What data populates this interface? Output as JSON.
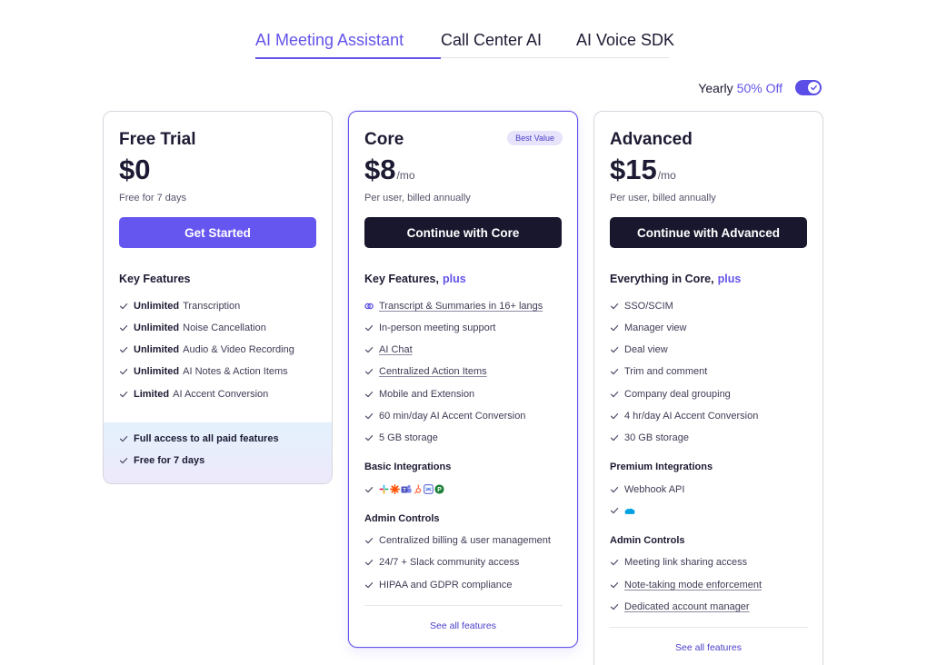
{
  "tabs": [
    {
      "label": "AI Meeting Assistant",
      "active": true
    },
    {
      "label": "Call Center AI",
      "active": false
    },
    {
      "label": "AI Voice SDK",
      "active": false
    }
  ],
  "billing": {
    "label": "Yearly",
    "discount": "50% Off",
    "yearly_enabled": true
  },
  "colors": {
    "accent": "#6353e8",
    "dark_button": "#19172e",
    "purple_button": "#6656f0"
  },
  "plans": {
    "free": {
      "name": "Free Trial",
      "price": "$0",
      "note": "Free for 7 days",
      "cta": "Get Started",
      "section_title": "Key Features",
      "features": [
        {
          "strong": "Unlimited",
          "text": "Transcription"
        },
        {
          "strong": "Unlimited",
          "text": "Noise Cancellation"
        },
        {
          "strong": "Unlimited",
          "text": "Audio & Video Recording"
        },
        {
          "strong": "Unlimited",
          "text": "AI Notes & Action Items"
        },
        {
          "strong": "Limited",
          "text": "AI Accent Conversion"
        }
      ],
      "extras": [
        "Full access to all paid features",
        "Free for 7 days"
      ]
    },
    "core": {
      "name": "Core",
      "badge": "Best Value",
      "price": "$8",
      "unit": "/mo",
      "note": "Per user, billed annually",
      "cta": "Continue with Core",
      "section_title": "Key Features,",
      "section_plus": "plus",
      "features": [
        "Transcript & Summaries in 16+ langs",
        "In-person meeting support",
        "AI Chat",
        "Centralized Action Items",
        "Mobile and Extension",
        "60 min/day AI Accent Conversion",
        "5 GB storage"
      ],
      "integrations_title": "Basic Integrations",
      "admin_title": "Admin Controls",
      "admin": [
        "Centralized billing & user management",
        "24/7 + Slack community access",
        "HIPAA and GDPR compliance"
      ],
      "see_all": "See all features"
    },
    "advanced": {
      "name": "Advanced",
      "price": "$15",
      "unit": "/mo",
      "note": "Per user, billed annually",
      "cta": "Continue with Advanced",
      "section_title": "Everything in Core,",
      "section_plus": "plus",
      "features": [
        "SSO/SCIM",
        "Manager view",
        "Deal view",
        "Trim and comment",
        "Company deal grouping",
        "4 hr/day AI Accent Conversion",
        "30 GB storage"
      ],
      "integrations_title": "Premium Integrations",
      "integrations": [
        "Webhook API"
      ],
      "admin_title": "Admin Controls",
      "admin": [
        "Meeting link sharing access",
        "Note-taking mode enforcement",
        "Dedicated account manager"
      ],
      "see_all": "See all features"
    }
  }
}
